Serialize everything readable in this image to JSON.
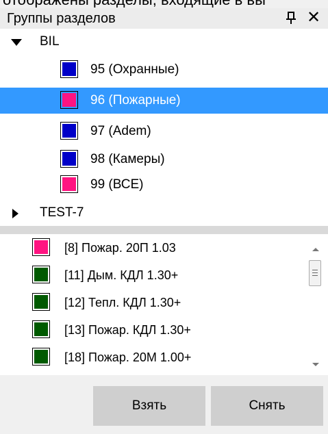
{
  "page_top_text": "отображены разделы, входящие в вы",
  "panel": {
    "title": "Группы разделов",
    "pin_icon": "pin-icon",
    "close_icon": "close-icon",
    "close_glyph": "✕"
  },
  "tree": {
    "groups": [
      {
        "label": "BIL",
        "expanded": true,
        "children": [
          {
            "label": "95 (Охранные)",
            "color": "#0000c8",
            "selected": false
          },
          {
            "label": "96 (Пожарные)",
            "color": "#ff1481",
            "selected": true
          },
          {
            "label": "97 (Adem)",
            "color": "#0000c8",
            "selected": false
          },
          {
            "label": "98 (Камеры)",
            "color": "#0000c8",
            "selected": false
          },
          {
            "label": "99 (ВСЕ)",
            "color": "#ff1481",
            "selected": false
          }
        ]
      },
      {
        "label": "TEST-7",
        "expanded": false,
        "children": []
      }
    ],
    "selection_color": "#3399ff"
  },
  "list": {
    "items": [
      {
        "label": "[8] Пожар. 20П 1.03",
        "color": "#ff1481"
      },
      {
        "label": "[11] Дым. КДЛ 1.30+",
        "color": "#005a00"
      },
      {
        "label": "[12] Тепл. КДЛ 1.30+",
        "color": "#005a00"
      },
      {
        "label": "[13] Пожар. КДЛ 1.30+",
        "color": "#005a00"
      },
      {
        "label": "[18] Пожар. 20М 1.00+",
        "color": "#005a00"
      }
    ]
  },
  "buttons": {
    "take": "Взять",
    "remove": "Снять"
  }
}
